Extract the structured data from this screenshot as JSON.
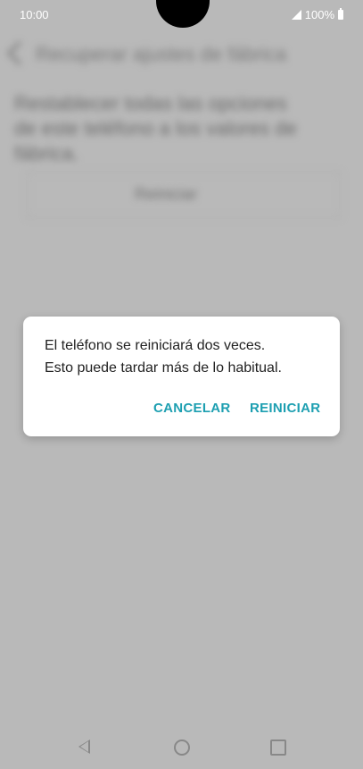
{
  "status_bar": {
    "time": "10:00",
    "battery": "100%"
  },
  "background": {
    "title": "Recuperar ajustes de fábrica",
    "body": "Restablecer todas las opciones de este teléfono a los valores de fábrica.",
    "button": "Reiniciar"
  },
  "dialog": {
    "message_line1": "El teléfono se reiniciará dos veces.",
    "message_line2": "Esto puede tardar más de lo habitual.",
    "cancel_label": "CANCELAR",
    "restart_label": "REINICIAR"
  },
  "colors": {
    "accent": "#1d9fb1",
    "overlay": "#b9b9b9"
  }
}
